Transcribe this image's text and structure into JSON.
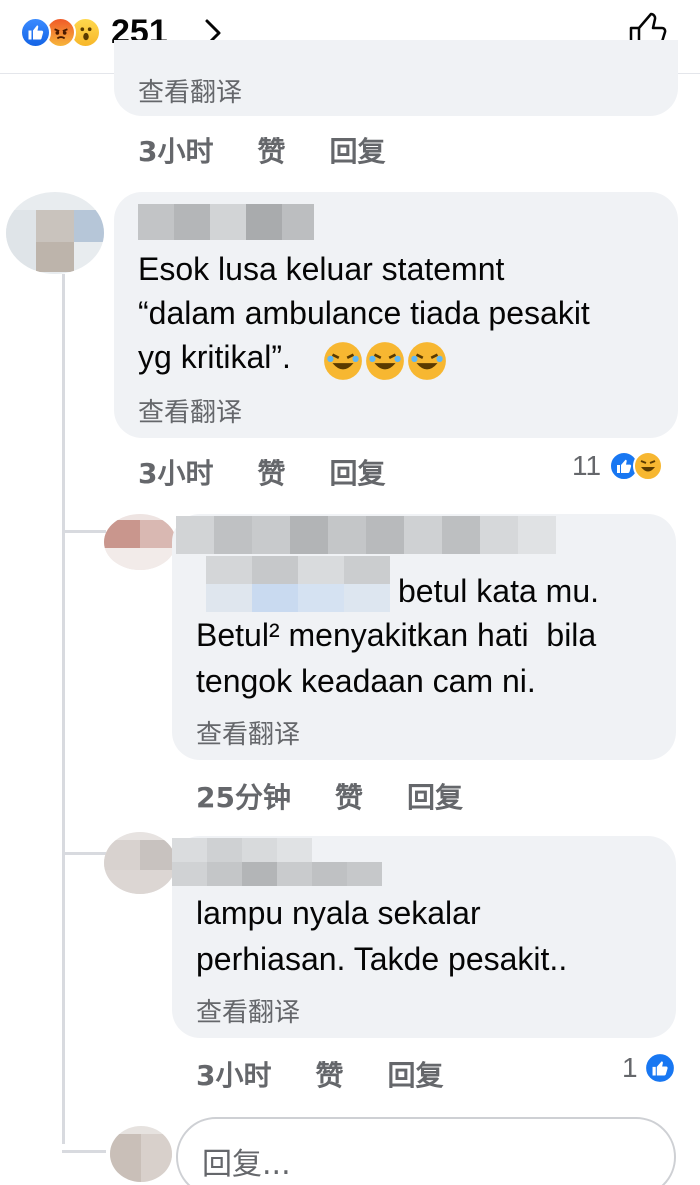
{
  "header": {
    "reaction_count": "251",
    "reactions": [
      "like-icon",
      "angry-icon",
      "wow-icon"
    ]
  },
  "top_comment": {
    "translate_label": "查看翻译",
    "time": "3小时",
    "like_label": "赞",
    "reply_label": "回复"
  },
  "comment_main": {
    "text_line1": "Esok lusa keluar statemnt",
    "text_line2": "“dalam ambulance tiada pesakit",
    "text_line3": "yg kritikal”.",
    "emojis": "🤣🤣🤣",
    "translate_label": "查看翻译",
    "time": "3小时",
    "like_label": "赞",
    "reply_label": "回复",
    "reaction_count": "11"
  },
  "reply_1": {
    "text_line1": "betul kata mu.",
    "text_line2": "Betul² menyakitkan hati  bila",
    "text_line3": "tengok keadaan cam ni.",
    "translate_label": "查看翻译",
    "time": "25分钟",
    "like_label": "赞",
    "reply_label": "回复"
  },
  "reply_2": {
    "text_line1": "lampu nyala sekalar",
    "text_line2": "perhiasan. Takde pesakit..",
    "translate_label": "查看翻译",
    "time": "3小时",
    "like_label": "赞",
    "reply_label": "回复",
    "reaction_count": "1"
  },
  "reply_input": {
    "placeholder": "回复..."
  },
  "colors": {
    "like_blue": "#1877f2",
    "bubble_bg": "#f0f2f5",
    "meta_gray": "#65676b"
  }
}
